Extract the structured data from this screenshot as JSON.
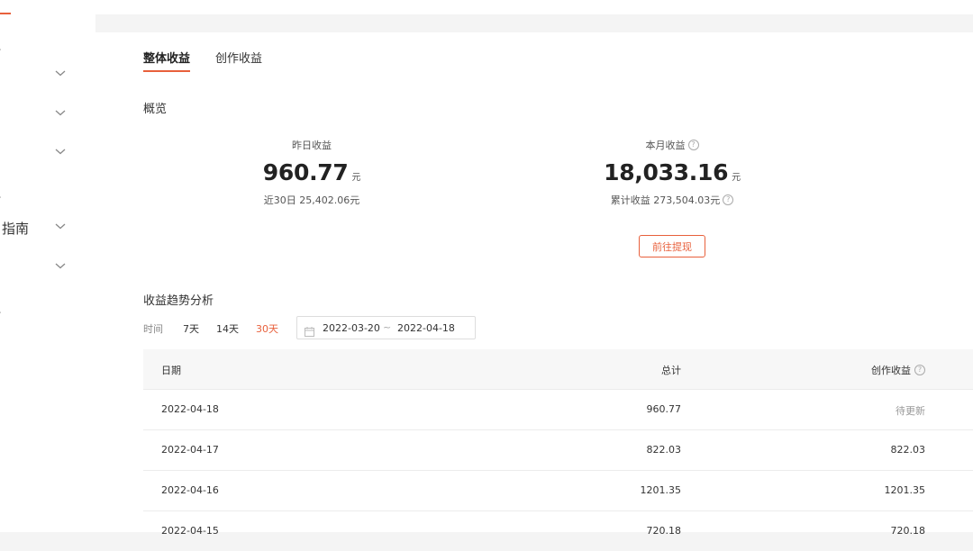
{
  "sidebar": {
    "items": [
      {
        "label": "",
        "tick": "、",
        "expandable": false
      },
      {
        "label": "",
        "tick": "",
        "expandable": true
      },
      {
        "label": "",
        "tick": "",
        "expandable": true
      },
      {
        "label": "",
        "tick": "",
        "expandable": true
      },
      {
        "label": "",
        "tick": "、",
        "expandable": false
      },
      {
        "label": "指南",
        "tick": "",
        "expandable": true
      },
      {
        "label": "",
        "tick": "",
        "expandable": true
      },
      {
        "label": "",
        "tick": "、",
        "expandable": false
      }
    ]
  },
  "tabs": [
    {
      "label": "整体收益",
      "active": true
    },
    {
      "label": "创作收益",
      "active": false
    }
  ],
  "overview": {
    "title": "概览",
    "yesterday": {
      "label": "昨日收益",
      "value": "960.77",
      "unit": "元",
      "sub": "近30日 25,402.06元"
    },
    "month": {
      "label": "本月收益",
      "value": "18,033.16",
      "unit": "元",
      "sub": "累计收益 273,504.03元"
    },
    "withdraw_button": "前往提现"
  },
  "trend": {
    "title": "收益趋势分析",
    "time_label": "时间",
    "ranges": [
      {
        "label": "7天",
        "active": false
      },
      {
        "label": "14天",
        "active": false
      },
      {
        "label": "30天",
        "active": true
      }
    ],
    "date_start": "2022-03-20",
    "date_sep": "~",
    "date_end": "2022-04-18"
  },
  "table": {
    "headers": {
      "date": "日期",
      "total": "总计",
      "creation": "创作收益"
    },
    "rows": [
      {
        "date": "2022-04-18",
        "total": "960.77",
        "creation": "待更新"
      },
      {
        "date": "2022-04-17",
        "total": "822.03",
        "creation": "822.03"
      },
      {
        "date": "2022-04-16",
        "total": "1201.35",
        "creation": "1201.35"
      },
      {
        "date": "2022-04-15",
        "total": "720.18",
        "creation": "720.18"
      }
    ]
  },
  "colors": {
    "accent": "#e8603c",
    "background": "#f4f4f4",
    "panel": "#ffffff"
  }
}
